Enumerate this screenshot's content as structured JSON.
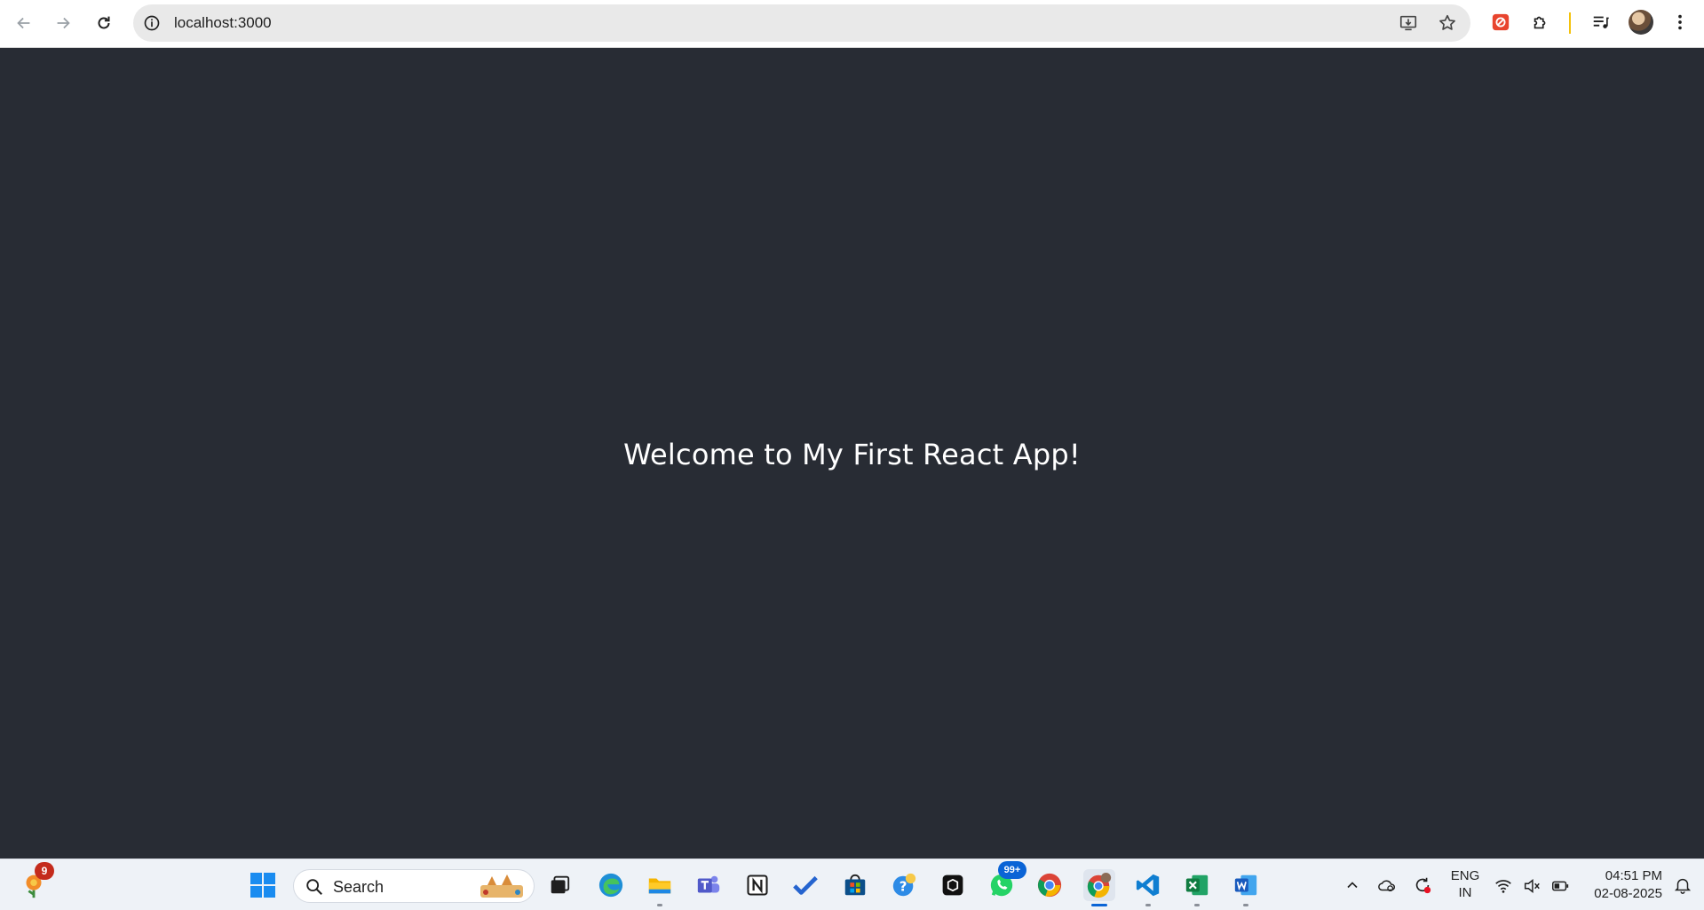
{
  "browser": {
    "url": "localhost:3000"
  },
  "page": {
    "heading": "Welcome to My First React App!"
  },
  "taskbar": {
    "widgets_badge": "9",
    "search_label": "Search",
    "whatsapp_badge": "99+",
    "language_line1": "ENG",
    "language_line2": "IN",
    "time": "04:51 PM",
    "date": "02-08-2025"
  },
  "colors": {
    "page_background": "#282c34",
    "heading_text": "#ffffff",
    "toolbar_background": "#ffffff",
    "omnibox_background": "#e9e9e9",
    "taskbar_background": "#eef2f7",
    "active_indicator": "#0a64d6"
  }
}
